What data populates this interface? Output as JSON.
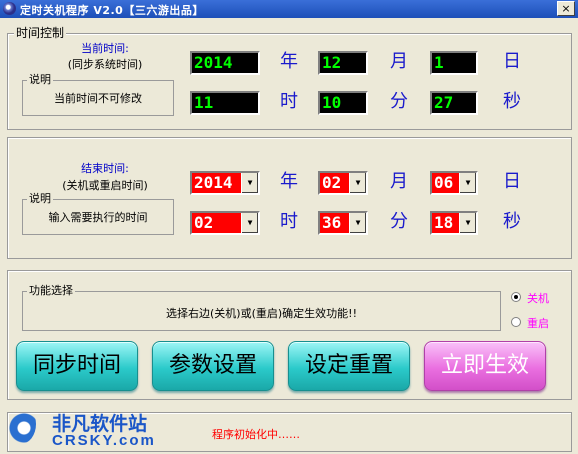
{
  "window": {
    "title": "定时关机程序 V2.0【三六游出品】",
    "close": "×"
  },
  "current_time": {
    "group_title": "时间控制",
    "label_line1": "当前时间:",
    "label_line2": "(同步系统时间)",
    "note_legend": "说明",
    "note_text": "当前时间不可修改",
    "year": "2014",
    "month": "12",
    "day": "1",
    "hour": "11",
    "minute": "10",
    "second": "27"
  },
  "units": {
    "year": "年",
    "month": "月",
    "day": "日",
    "hour": "时",
    "minute": "分",
    "second": "秒"
  },
  "end_time": {
    "label_line1": "结束时间:",
    "label_line2": "(关机或重启时间)",
    "note_legend": "说明",
    "note_text": "输入需要执行的时间",
    "year": "2014",
    "month": "02",
    "day": "06",
    "hour": "02",
    "minute": "36",
    "second": "18"
  },
  "function": {
    "legend": "功能选择",
    "text": "选择右边(关机)或(重启)确定生效功能!!",
    "options": [
      {
        "label": "关机",
        "checked": true
      },
      {
        "label": "重启",
        "checked": false
      }
    ]
  },
  "buttons": {
    "sync": "同步时间",
    "settings": "参数设置",
    "reset": "设定重置",
    "apply": "立即生效"
  },
  "status": {
    "text": "程序初始化中……"
  },
  "watermark": {
    "cn": "非凡软件站",
    "en": "CRSKY.com"
  }
}
